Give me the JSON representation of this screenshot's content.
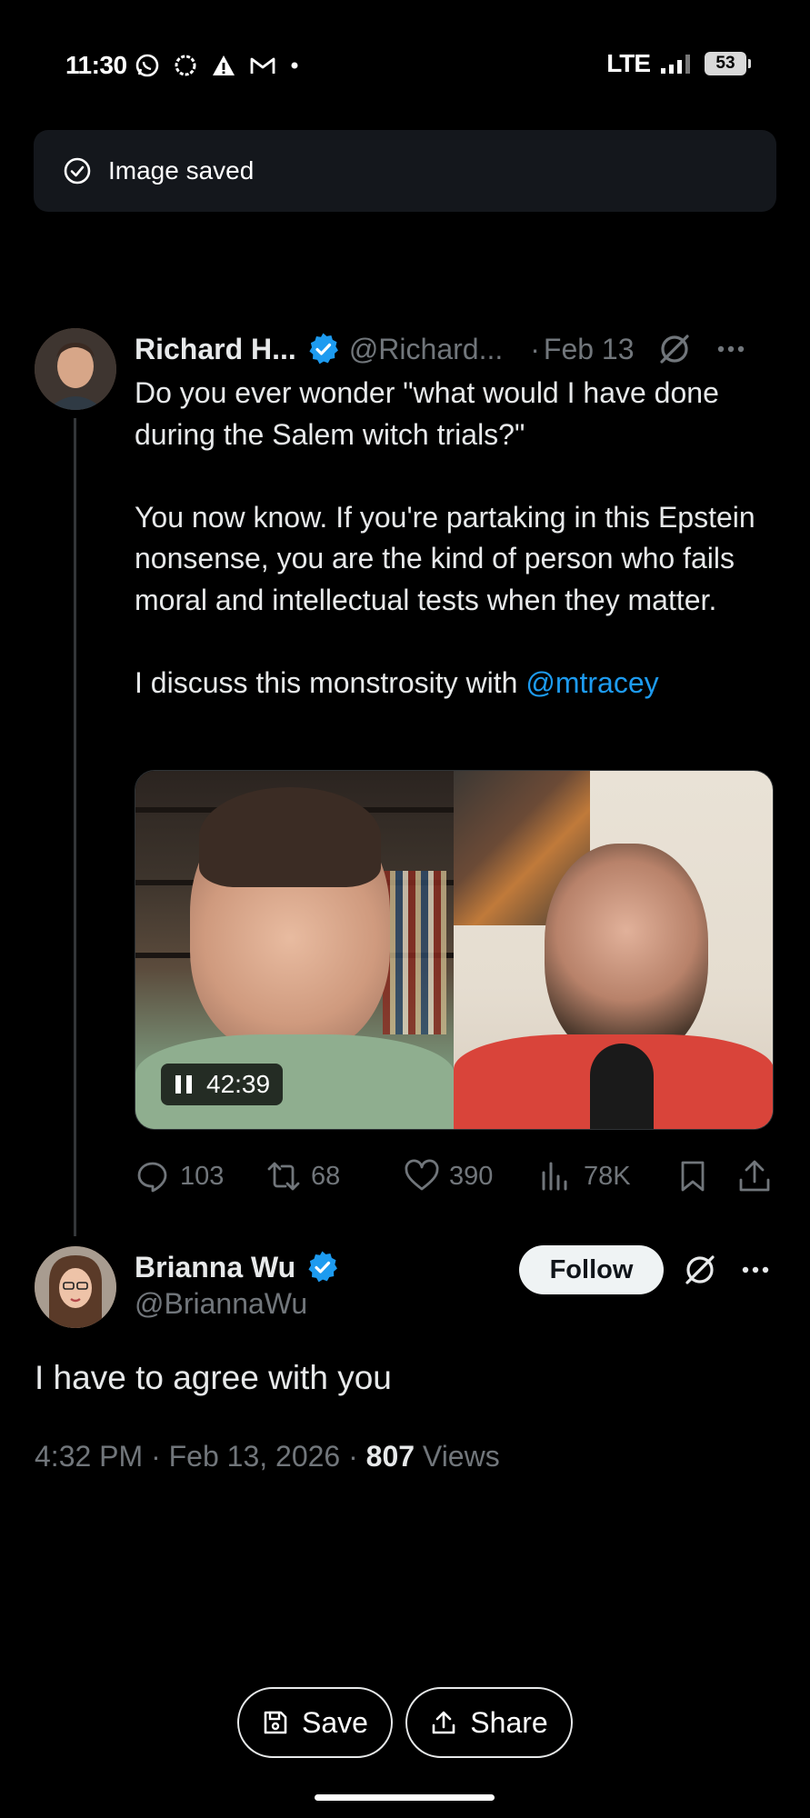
{
  "status_bar": {
    "time": "11:30",
    "network": "LTE",
    "battery": "53",
    "icons": [
      "whatsapp-icon",
      "chat-bubble-icon",
      "warning-icon",
      "gmail-icon",
      "dot-icon"
    ]
  },
  "toast": {
    "icon": "check-circle-icon",
    "text": "Image saved"
  },
  "tweet": {
    "author_name": "Richard H...",
    "handle": "@Richard...",
    "separator": "·",
    "date": "Feb 13",
    "body_lines": [
      "Do you ever wonder \"what would I have done during the Salem witch trials?\"",
      "You now know. If you're partaking in this Epstein nonsense, you are the kind of person who fails moral and intellectual tests when they matter.",
      "I discuss this monstrosity with "
    ],
    "mention": "@mtracey",
    "video": {
      "duration": "42:39"
    },
    "stats": {
      "replies": "103",
      "retweets": "68",
      "likes": "390",
      "views": "78K"
    }
  },
  "reply": {
    "author_name": "Brianna Wu",
    "handle": "@BriannaWu",
    "follow_label": "Follow",
    "body": "I have to agree with you",
    "timestamp": "4:32 PM · Feb 13, 2026 · ",
    "views_count": "807",
    "views_label": " Views"
  },
  "bottom_actions": {
    "save_label": "Save",
    "share_label": "Share"
  },
  "colors": {
    "background": "#000000",
    "accent": "#1d9bf0",
    "secondary_text": "#71767b",
    "toast_bg": "#14171c"
  }
}
